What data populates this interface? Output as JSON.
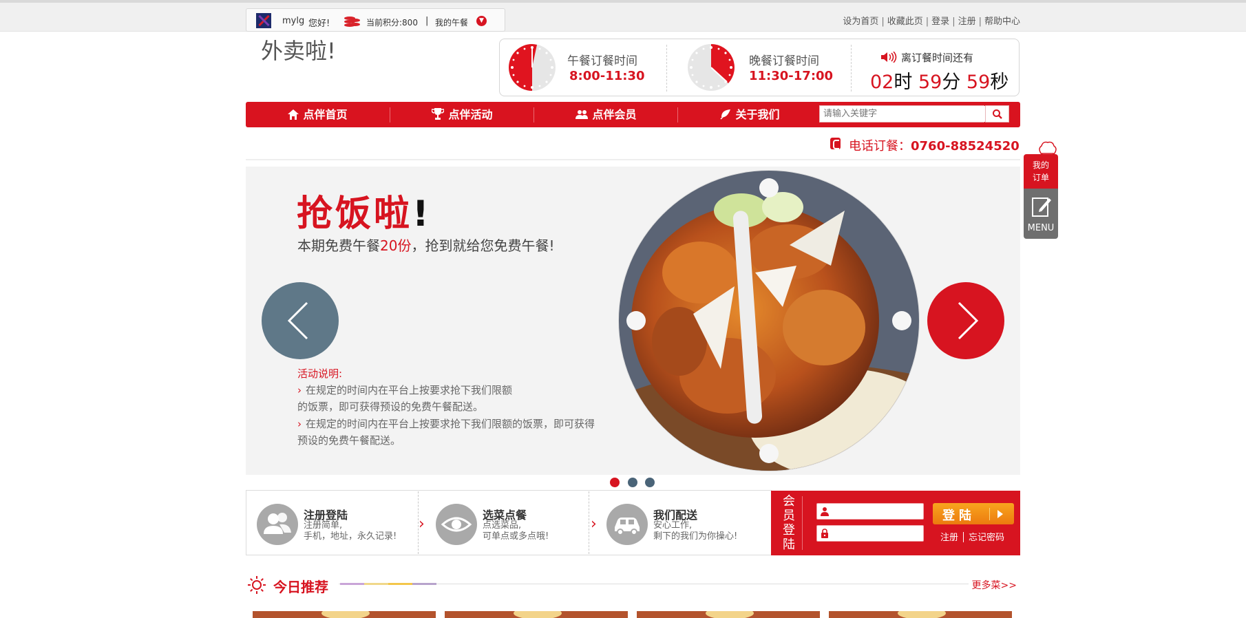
{
  "topbar": {
    "username": "mylg",
    "greeting": "您好!",
    "points": "当前积分:800",
    "sep": "|",
    "my_lunch": "我的午餐",
    "links": [
      "设为首页",
      "收藏此页",
      "登录",
      "注册",
      "帮助中心"
    ]
  },
  "logo": "外卖啦!",
  "timebox": {
    "lunch_title": "午餐订餐时间",
    "lunch_time": "8:00-11:30",
    "dinner_title": "晚餐订餐时间",
    "dinner_time": "11:30-17:00",
    "countdown_label": "离订餐时间还有",
    "hours": "02",
    "hours_unit": "时",
    "minutes": "59",
    "minutes_unit": "分",
    "seconds": "59",
    "seconds_unit": "秒"
  },
  "nav": {
    "items": [
      "点伴首页",
      "点伴活动",
      "点伴会员",
      "关于我们"
    ],
    "search_placeholder": "请输入关键字"
  },
  "phone": {
    "label": "电话订餐：",
    "number": "0760-88524520"
  },
  "banner": {
    "title": "抢饭啦",
    "title_mark": "!",
    "subtitle_pre": "本期免费午餐",
    "subtitle_num": "20份",
    "subtitle_post": "，抢到就给您免费午餐!",
    "rule_title": "活动说明:",
    "rule1_line1": "在规定的时间内在平台上按要求抢下我们限额",
    "rule1_line2": "的饭票，即可获得预设的免费午餐配送。",
    "rule2_line1": "在规定的时间内在平台上按要求抢下我们限额的饭票，即可获得",
    "rule2_line2": "预设的免费午餐配送。",
    "dots_colors": [
      "#d71420",
      "#4a6478",
      "#4a6478"
    ]
  },
  "steps": [
    {
      "title": "注册登陆",
      "desc1": "注册简单,",
      "desc2": "手机，地址，永久记录!"
    },
    {
      "title": "选菜点餐",
      "desc1": "点选菜品,",
      "desc2": "可单点或多点哦!"
    },
    {
      "title": "我们配送",
      "desc1": "安心工作,",
      "desc2": "剩下的我们为你操心!"
    }
  ],
  "login": {
    "vertical": [
      "会",
      "员",
      "登",
      "陆"
    ],
    "button": "登陆",
    "register": "注册",
    "forgot": "忘记密码"
  },
  "recommend": {
    "title": "今日推荐",
    "more": "更多菜>>"
  },
  "sidebar": {
    "order_line1": "我的",
    "order_line2": "订单",
    "menu": "MENU"
  },
  "colors": {
    "brand_red": "#d71420",
    "slate": "#5f7888",
    "orange": "#f39214"
  }
}
